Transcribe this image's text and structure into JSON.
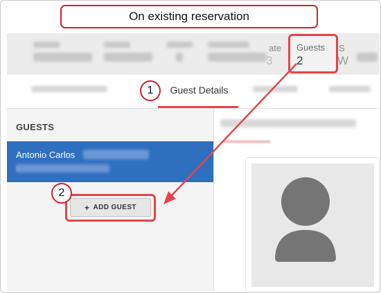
{
  "annotation": {
    "title": "On existing reservation",
    "callout_1": "1",
    "callout_2": "2"
  },
  "reservation_header": {
    "partial_label_left": "ate",
    "guests_label": "Guests",
    "guests_value": "2",
    "partial_label_right": "S",
    "partial_value_left": "3",
    "partial_value_right": "W"
  },
  "tabs": {
    "active_label": "Guest Details"
  },
  "guests_panel": {
    "heading": "GUESTS",
    "guest_name": "Antonio Carlos",
    "email_initial": "s",
    "add_button_label": "ADD GUEST",
    "add_button_icon": "plus-icon"
  },
  "colors": {
    "annotation_red": "#d42027",
    "highlight_red": "#e2454b",
    "selected_blue": "#2f6fc0"
  }
}
